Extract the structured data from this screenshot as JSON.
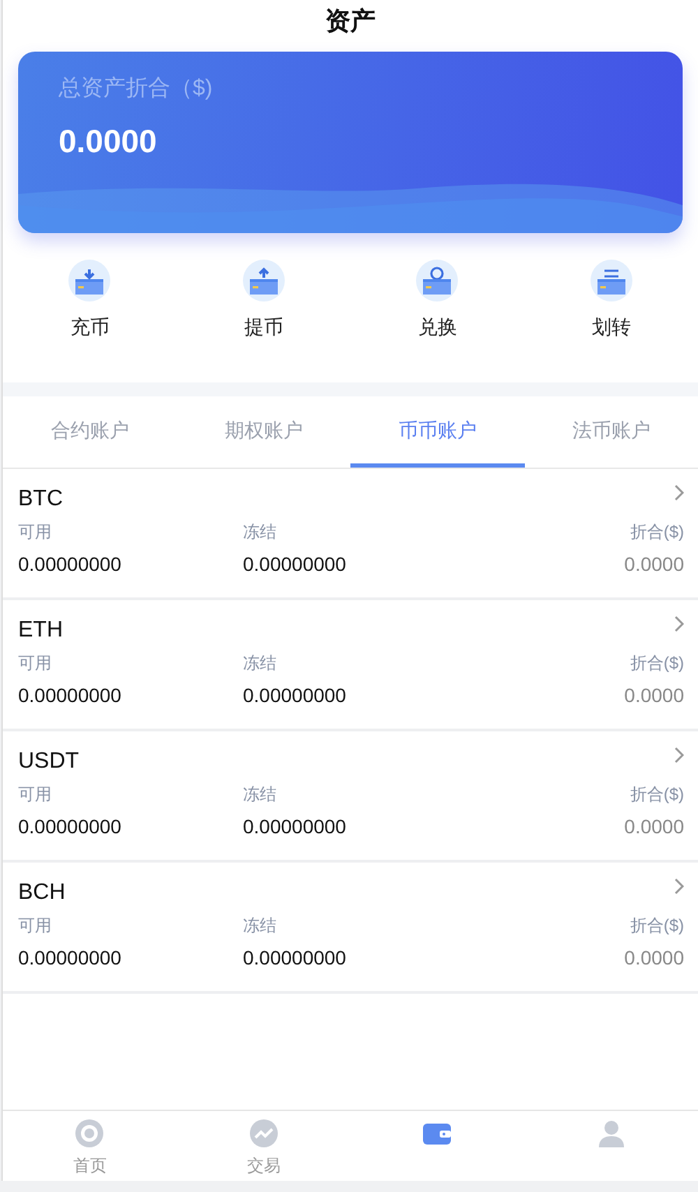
{
  "header": {
    "title": "资产"
  },
  "summary": {
    "label": "总资产折合（$)",
    "value": "0.0000"
  },
  "actions": [
    {
      "kind": "deposit",
      "label": "充币"
    },
    {
      "kind": "withdraw",
      "label": "提币"
    },
    {
      "kind": "exchange",
      "label": "兑换"
    },
    {
      "kind": "transfer",
      "label": "划转"
    }
  ],
  "tabs": [
    {
      "label": "合约账户",
      "selected": false
    },
    {
      "label": "期权账户",
      "selected": false
    },
    {
      "label": "币币账户",
      "selected": true
    },
    {
      "label": "法币账户",
      "selected": false
    }
  ],
  "assets": [
    {
      "symbol": "BTC",
      "available_label": "可用",
      "frozen_label": "冻结",
      "value_label": "折合($)",
      "available": "0.00000000",
      "frozen": "0.00000000",
      "value": "0.0000"
    },
    {
      "symbol": "ETH",
      "available_label": "可用",
      "frozen_label": "冻结",
      "value_label": "折合($)",
      "available": "0.00000000",
      "frozen": "0.00000000",
      "value": "0.0000"
    },
    {
      "symbol": "USDT",
      "available_label": "可用",
      "frozen_label": "冻结",
      "value_label": "折合($)",
      "available": "0.00000000",
      "frozen": "0.00000000",
      "value": "0.0000"
    },
    {
      "symbol": "BCH",
      "available_label": "可用",
      "frozen_label": "冻结",
      "value_label": "折合($)",
      "available": "0.00000000",
      "frozen": "0.00000000",
      "value": "0.0000"
    }
  ],
  "bottom_nav": [
    {
      "kind": "home",
      "label": "首页",
      "selected": false
    },
    {
      "kind": "trade",
      "label": "交易",
      "selected": false
    },
    {
      "kind": "wallet",
      "selected": true
    },
    {
      "kind": "user",
      "selected": false
    }
  ]
}
